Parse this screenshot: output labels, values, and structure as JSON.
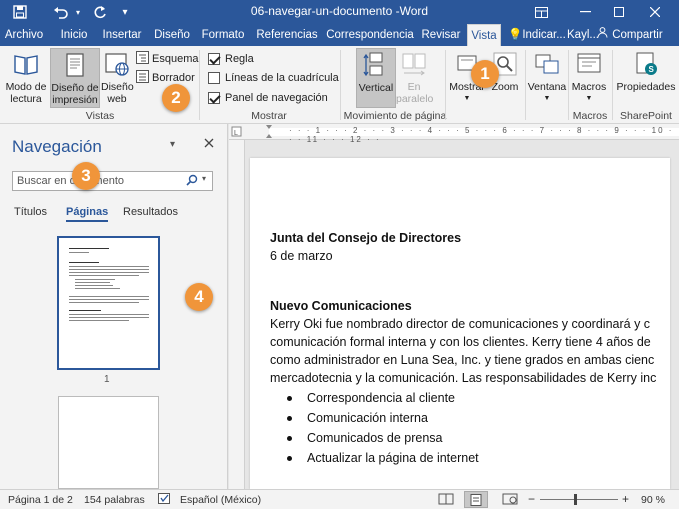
{
  "window": {
    "title": "06-navegar-un-documento -Word",
    "controls": [
      "restore-ribbon",
      "minimize",
      "maximize",
      "close"
    ]
  },
  "tabs": [
    {
      "label": "Archivo"
    },
    {
      "label": "Inicio"
    },
    {
      "label": "Insertar"
    },
    {
      "label": "Diseño"
    },
    {
      "label": "Formato"
    },
    {
      "label": "Referencias"
    },
    {
      "label": "Correspondencia"
    },
    {
      "label": "Revisar"
    },
    {
      "label": "Vista",
      "active": true
    }
  ],
  "tell_me": "Indicar...",
  "user": "Kayl...",
  "share": "Compartir",
  "ribbon": {
    "vistas": {
      "label": "Vistas",
      "read_mode": [
        "Modo de",
        "lectura"
      ],
      "print_layout": [
        "Diseño de",
        "impresión"
      ],
      "web_layout": [
        "Diseño",
        "web"
      ],
      "outline": "Esquema",
      "draft": "Borrador"
    },
    "mostrar": {
      "label": "Mostrar",
      "ruler": "Regla",
      "ruler_checked": true,
      "gridlines": "Líneas de la cuadrícula",
      "gridlines_checked": false,
      "nav_pane": "Panel de navegación",
      "nav_pane_checked": true
    },
    "movimiento": {
      "label": "Movimiento de página",
      "vertical": "Vertical",
      "side": [
        "En",
        "paralelo"
      ]
    },
    "zoom": {
      "show": "Mostrar",
      "zoom": "Zoom"
    },
    "window": {
      "label": "Ventana"
    },
    "macros": {
      "button": "Macros",
      "label": "Macros"
    },
    "sharepoint": {
      "button": "Propiedades",
      "label": "SharePoint"
    }
  },
  "nav": {
    "title": "Navegación",
    "search_placeholder": "Buscar en documento",
    "tabs": [
      "Títulos",
      "Páginas",
      "Resultados"
    ],
    "selected_tab": "Páginas",
    "page1_number": "1"
  },
  "document": {
    "heading1": "Junta del Consejo de Directores",
    "date": "6 de marzo",
    "heading2": "Nuevo Comunicaciones",
    "paragraph": [
      "Kerry Oki fue nombrado director de comunicaciones y coordinará y c",
      "comunicación formal interna y con los clientes. Kerry tiene 4 años de",
      "como administrador en Luna Sea, Inc. y tiene grados en ambas cienc",
      "mercadotecnia y la comunicación. Las responsabilidades de Kerry inc"
    ],
    "bullets": [
      "Correspondencia al cliente",
      "Comunicación interna",
      "Comunicados de prensa",
      "Actualizar la página de internet"
    ]
  },
  "status": {
    "page": "Página 1 de 2",
    "words": "154 palabras",
    "language": "Español (México)",
    "zoom": "90 %"
  },
  "callouts": [
    "1",
    "2",
    "3",
    "4"
  ],
  "colors": {
    "accent": "#2b579a",
    "callout": "#f0953a"
  }
}
